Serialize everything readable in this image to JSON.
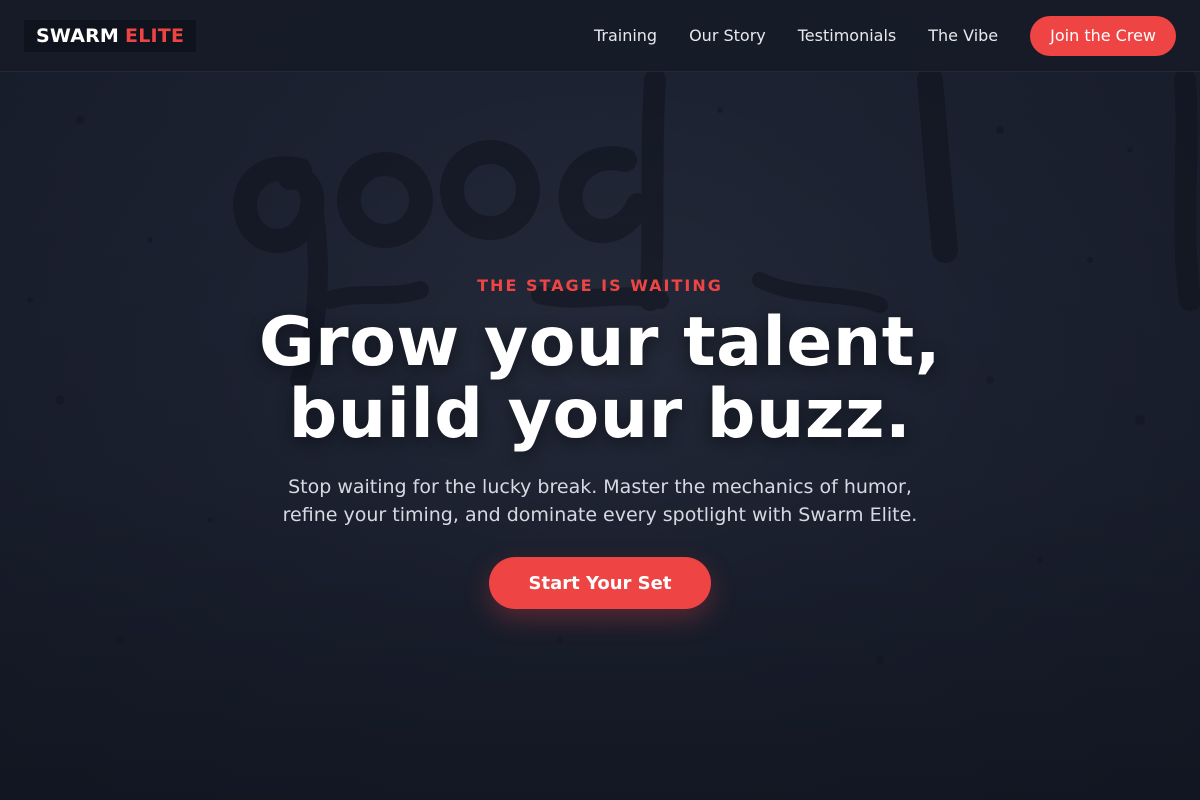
{
  "brand": {
    "name_part1": "SWARM",
    "name_part2": "ELITE",
    "accent_color": "#ef4444"
  },
  "nav": {
    "links": [
      {
        "label": "Training"
      },
      {
        "label": "Our Story"
      },
      {
        "label": "Testimonials"
      },
      {
        "label": "The Vibe"
      }
    ],
    "cta_label": "Join the Crew"
  },
  "hero": {
    "eyebrow": "THE STAGE IS WAITING",
    "headline_line1": "Grow your talent,",
    "headline_line2": "build your buzz.",
    "subcopy_line1": "Stop waiting for the lucky break. Master the mechanics of humor,",
    "subcopy_line2": "refine your timing, and dominate every spotlight with Swarm Elite.",
    "cta_label": "Start Your Set"
  }
}
